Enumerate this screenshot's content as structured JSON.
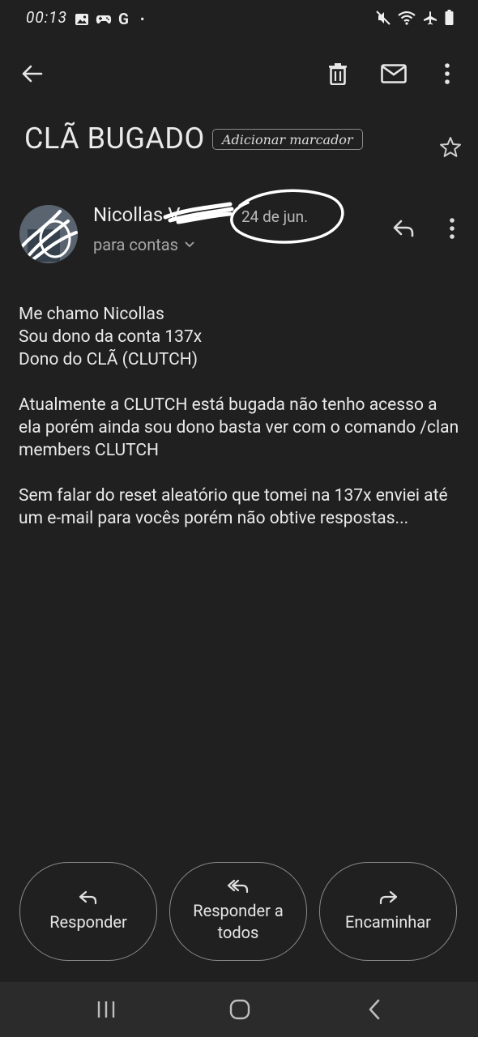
{
  "status_bar": {
    "time": "00:13",
    "google_glyph": "G",
    "dot": "•",
    "left_icons": [
      "image-icon",
      "game-controller-icon",
      "google-icon",
      "notification-dot"
    ],
    "right_icons": [
      "mute-icon",
      "wifi-icon",
      "airplane-icon",
      "battery-icon"
    ]
  },
  "toolbar": {
    "icons": [
      "back-arrow-icon",
      "trash-icon",
      "mail-icon",
      "more-vert-icon"
    ]
  },
  "subject": {
    "title": "CLÃ BUGADO",
    "add_label": "Adicionar marcador"
  },
  "message": {
    "sender_name": "Nicollas V",
    "date": "24 de jun.",
    "to_line": "para contas",
    "body": [
      "Me chamo Nicollas\nSou dono da conta 137x\nDono do CLÃ (CLUTCH)",
      "Atualmente a CLUTCH está bugada não tenho acesso a ela porém ainda sou dono basta ver com o comando /clan members CLUTCH",
      "Sem falar do reset aleatório que tomei na 137x enviei até um e-mail para vocês porém não obtive respostas..."
    ]
  },
  "actions": {
    "reply": "Responder",
    "reply_all": "Responder a todos",
    "forward": "Encaminhar"
  },
  "colors": {
    "background": "#202020",
    "text": "#eaeaea",
    "muted": "#a8a8a8",
    "outline": "#8a8a8a"
  }
}
